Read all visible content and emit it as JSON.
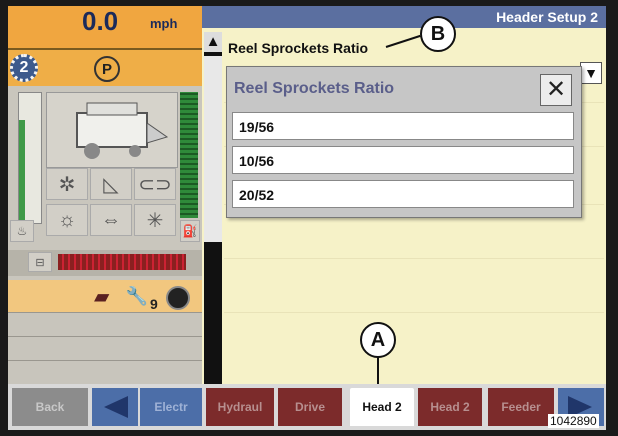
{
  "speed": {
    "value": "0.0",
    "unit": "mph"
  },
  "gear": {
    "number": "2",
    "park": "P"
  },
  "counter": "9",
  "screen_title": "Header Setup 2",
  "field": {
    "label": "Reel Sprockets Ratio"
  },
  "popup": {
    "title": "Reel Sprockets Ratio",
    "close": "✕",
    "options": [
      "19/56",
      "10/56",
      "20/52"
    ]
  },
  "callouts": {
    "a": "A",
    "b": "B"
  },
  "nav": {
    "back": "Back",
    "electr": "Electr",
    "hydraul": "Hydraul",
    "drive": "Drive",
    "head2_active": "Head 2",
    "head2": "Head 2",
    "feeder": "Feeder"
  },
  "figure_code": "1042890",
  "colors": {
    "title_bar": "#5b6fa0",
    "nav_red": "#7c2b2b",
    "speed_bg": "#f0a640",
    "panel_bg": "#f6f2c8"
  }
}
